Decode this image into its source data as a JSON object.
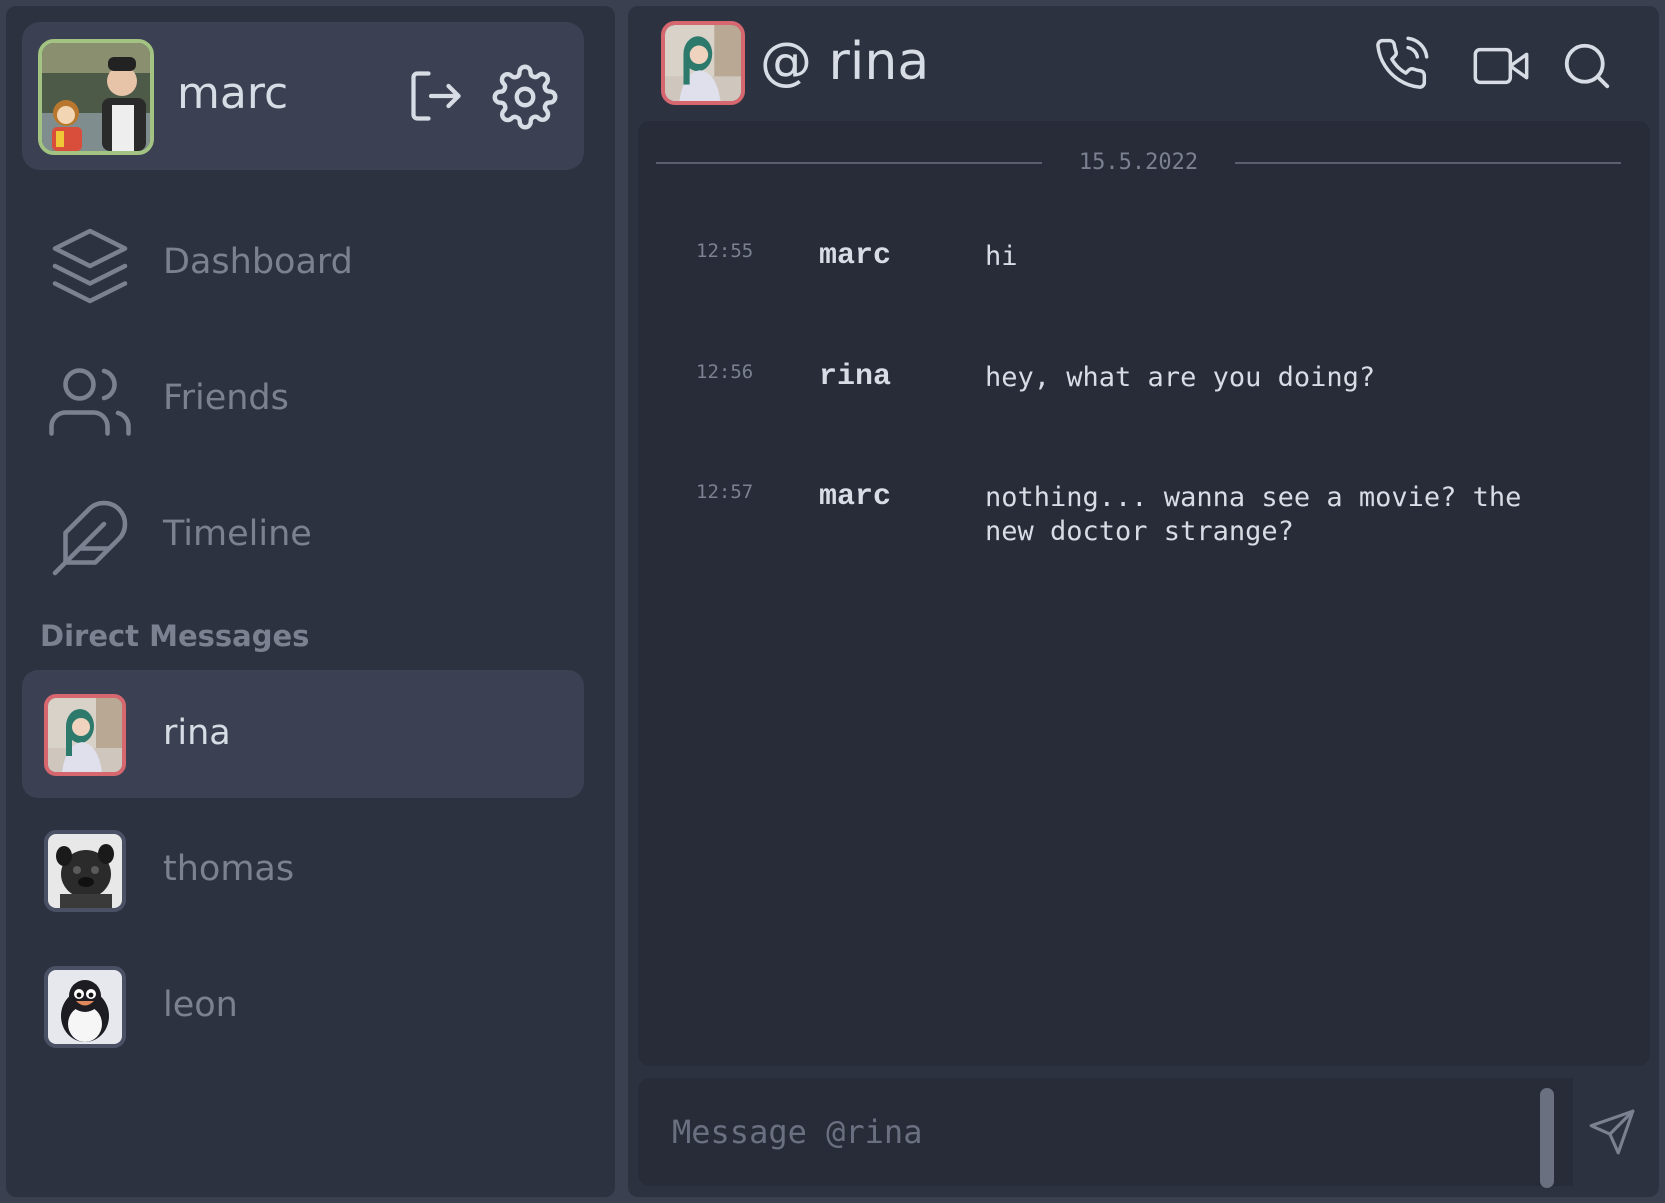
{
  "colors": {
    "accent_active": "#d6676f",
    "accent_user": "#a3c383",
    "text_primary": "#d8dce4",
    "text_muted": "#7b8190"
  },
  "current_user": {
    "name": "marc",
    "avatar": "monkey-and-man-photo"
  },
  "user_actions": {
    "logout_icon": "logout-icon",
    "settings_icon": "gear-icon"
  },
  "nav": {
    "items": [
      {
        "label": "Dashboard",
        "icon": "layers-icon"
      },
      {
        "label": "Friends",
        "icon": "users-icon"
      },
      {
        "label": "Timeline",
        "icon": "feather-icon"
      }
    ]
  },
  "direct_messages": {
    "title": "Direct Messages",
    "items": [
      {
        "name": "rina",
        "avatar": "woman-photo",
        "active": true
      },
      {
        "name": "thomas",
        "avatar": "pug-photo",
        "active": false
      },
      {
        "name": "leon",
        "avatar": "penguin-avatar",
        "active": false
      }
    ]
  },
  "chat": {
    "header": {
      "title": "@ rina",
      "icons": [
        "phone-icon",
        "video-icon",
        "search-icon"
      ]
    },
    "date_separator": "15.5.2022",
    "messages": [
      {
        "time": "12:55",
        "author": "marc",
        "text": "hi"
      },
      {
        "time": "12:56",
        "author": "rina",
        "text": "hey, what are you doing?"
      },
      {
        "time": "12:57",
        "author": "marc",
        "text": "nothing... wanna see a movie? the new doctor strange?"
      }
    ],
    "composer": {
      "placeholder": "Message @rina",
      "value": "",
      "send_icon": "send-icon"
    }
  }
}
